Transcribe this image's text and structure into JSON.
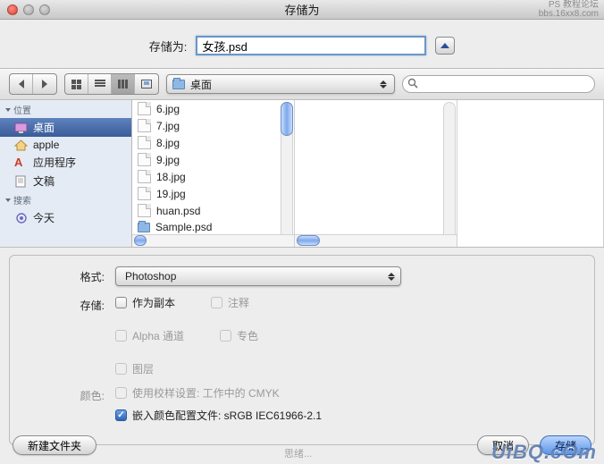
{
  "window": {
    "title": "存储为"
  },
  "watermark": {
    "top1": "PS 教程论坛",
    "top2": "bbs.16xx8.com",
    "bottom_small": "思绪...",
    "bottom_big": "UiBQ.cOm"
  },
  "save": {
    "label": "存储为:",
    "filename": "女孩.psd"
  },
  "location": {
    "label": "桌面"
  },
  "search": {
    "placeholder": ""
  },
  "sidebar": {
    "sections": [
      {
        "title": "位置",
        "items": [
          {
            "label": "桌面",
            "icon": "desktop",
            "selected": true
          },
          {
            "label": "apple",
            "icon": "home"
          },
          {
            "label": "应用程序",
            "icon": "apps"
          },
          {
            "label": "文稿",
            "icon": "docs"
          }
        ]
      },
      {
        "title": "搜索",
        "items": [
          {
            "label": "今天",
            "icon": "search"
          }
        ]
      }
    ]
  },
  "files": {
    "col1": [
      {
        "name": "6.jpg",
        "type": "file"
      },
      {
        "name": "7.jpg",
        "type": "file"
      },
      {
        "name": "8.jpg",
        "type": "file"
      },
      {
        "name": "9.jpg",
        "type": "file"
      },
      {
        "name": "18.jpg",
        "type": "file"
      },
      {
        "name": "19.jpg",
        "type": "file"
      },
      {
        "name": "huan.psd",
        "type": "file"
      },
      {
        "name": "Sample.psd",
        "type": "folder"
      }
    ]
  },
  "format": {
    "label": "格式:",
    "value": "Photoshop",
    "store_label": "存储:",
    "opts": {
      "as_copy": "作为副本",
      "notes": "注释",
      "alpha": "Alpha 通道",
      "spot": "专色",
      "layers": "图层"
    },
    "color_label": "颜色:",
    "proof": "使用校样设置: 工作中的 CMYK",
    "embed": "嵌入颜色配置文件: sRGB IEC61966-2.1"
  },
  "buttons": {
    "new_folder": "新建文件夹",
    "cancel": "取消",
    "save": "存储"
  }
}
